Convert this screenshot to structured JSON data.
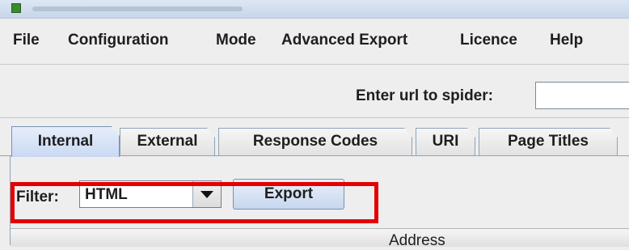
{
  "menu": {
    "file": "File",
    "configuration": "Configuration",
    "mode": "Mode",
    "advanced_export": "Advanced Export",
    "licence": "Licence",
    "help": "Help"
  },
  "spider": {
    "url_label": "Enter url to spider:",
    "url_value": ""
  },
  "tabs": [
    {
      "label": "Internal",
      "active": true
    },
    {
      "label": "External",
      "active": false
    },
    {
      "label": "Response Codes",
      "active": false
    },
    {
      "label": "URI",
      "active": false
    },
    {
      "label": "Page Titles",
      "active": false
    }
  ],
  "filter": {
    "label": "Filter:",
    "selected": "HTML",
    "export_label": "Export"
  },
  "table": {
    "columns": [
      "Address"
    ]
  },
  "colors": {
    "highlight": "#e30000",
    "tab_active": "#c9d9f2"
  }
}
